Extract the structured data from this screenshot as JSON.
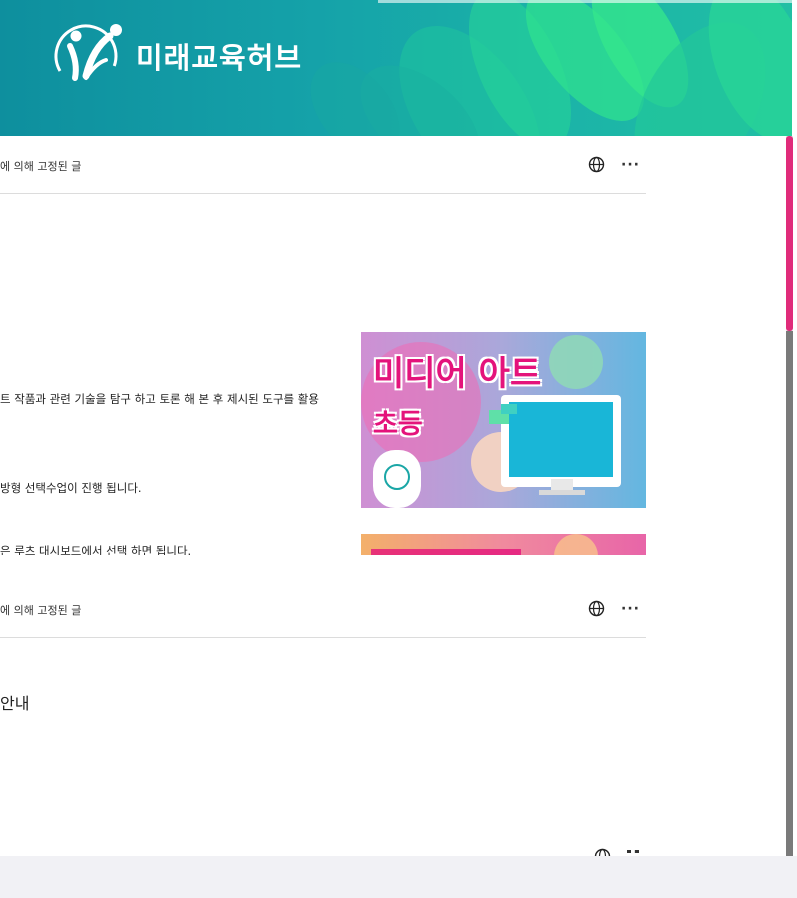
{
  "banner": {
    "brand_name": "미래교육허브",
    "logo_icon": "people-leaf-logo-icon",
    "colors": {
      "teal": "#0e8f9e",
      "leaf": "#2fd98f"
    }
  },
  "posts": [
    {
      "pinned_label": "에 의해 고정된 글",
      "icons": [
        "globe-icon",
        "more-icon"
      ],
      "more_label": "···",
      "lines": [
        "트 작품과 관련 기술을 탐구 하고 토론 해 본 후 제시된 도구를 활용",
        "방형 선택수업이 진행 됩니다.",
        "은 루츠 대시보드에서 선택 하면 됩니다."
      ],
      "thumbnail": {
        "title": "미디어 아트",
        "subtitle": "초등",
        "accent": "#e02b7a"
      }
    },
    {
      "pinned_label": "에 의해 고정된 글",
      "icons": [
        "globe-icon",
        "more-icon"
      ],
      "more_label": "···",
      "title": "안내"
    }
  ],
  "scrollbar": {
    "thumb_color": "#e02b7a"
  }
}
